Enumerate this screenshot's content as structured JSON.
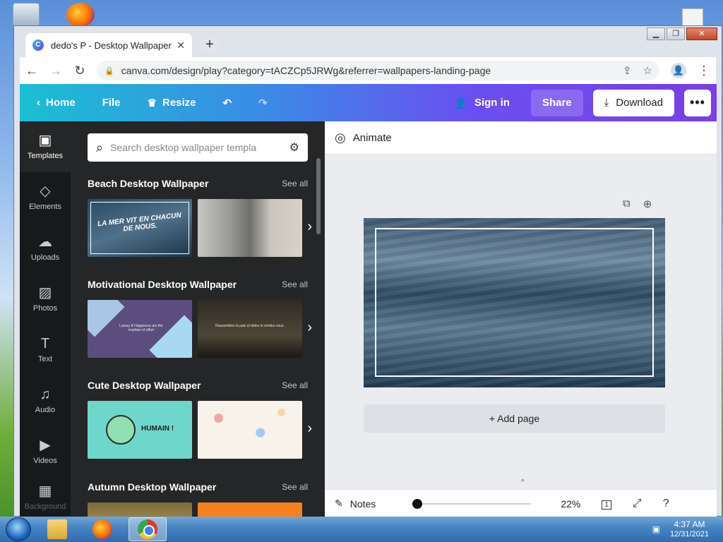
{
  "browser": {
    "tab_title": "dedo's P - Desktop Wallpaper",
    "tab_favicon_letter": "C",
    "url": "canva.com/design/play?category=tACZCp5JRWg&referrer=wallpapers-landing-page"
  },
  "canva": {
    "topbar": {
      "home": "Home",
      "file": "File",
      "resize": "Resize",
      "sign_in": "Sign in",
      "share": "Share",
      "download": "Download",
      "more": "•••"
    },
    "rail": [
      {
        "label": "Templates",
        "icon": "▣"
      },
      {
        "label": "Elements",
        "icon": "◇"
      },
      {
        "label": "Uploads",
        "icon": "☁"
      },
      {
        "label": "Photos",
        "icon": "▨"
      },
      {
        "label": "Text",
        "icon": "T"
      },
      {
        "label": "Audio",
        "icon": "♫"
      },
      {
        "label": "Videos",
        "icon": "▶"
      },
      {
        "label": "Background",
        "icon": "▦"
      }
    ],
    "search_placeholder": "Search desktop wallpaper templa",
    "sections": [
      {
        "title": "Beach Desktop Wallpaper",
        "see_all": "See all",
        "thumb1_text": "LA MER VIT EN CHACUN DE NOUS."
      },
      {
        "title": "Motivational Desktop Wallpaper",
        "see_all": "See all",
        "thumb1_text": "Luxury & Happiness are the trophies of effort",
        "thumb2_text": "Rassemblez la paix et faites le rendez-vous."
      },
      {
        "title": "Cute Desktop Wallpaper",
        "see_all": "See all",
        "thumb1_text": "HUMAIN !"
      },
      {
        "title": "Autumn Desktop Wallpaper",
        "see_all": "See all"
      }
    ],
    "editor": {
      "animate": "Animate",
      "add_page": "+ Add page",
      "notes": "Notes",
      "zoom": "22%",
      "page_count": "1",
      "zoom_level": 0.22
    }
  },
  "taskbar": {
    "time": "4:37 AM",
    "date": "12/31/2021"
  }
}
